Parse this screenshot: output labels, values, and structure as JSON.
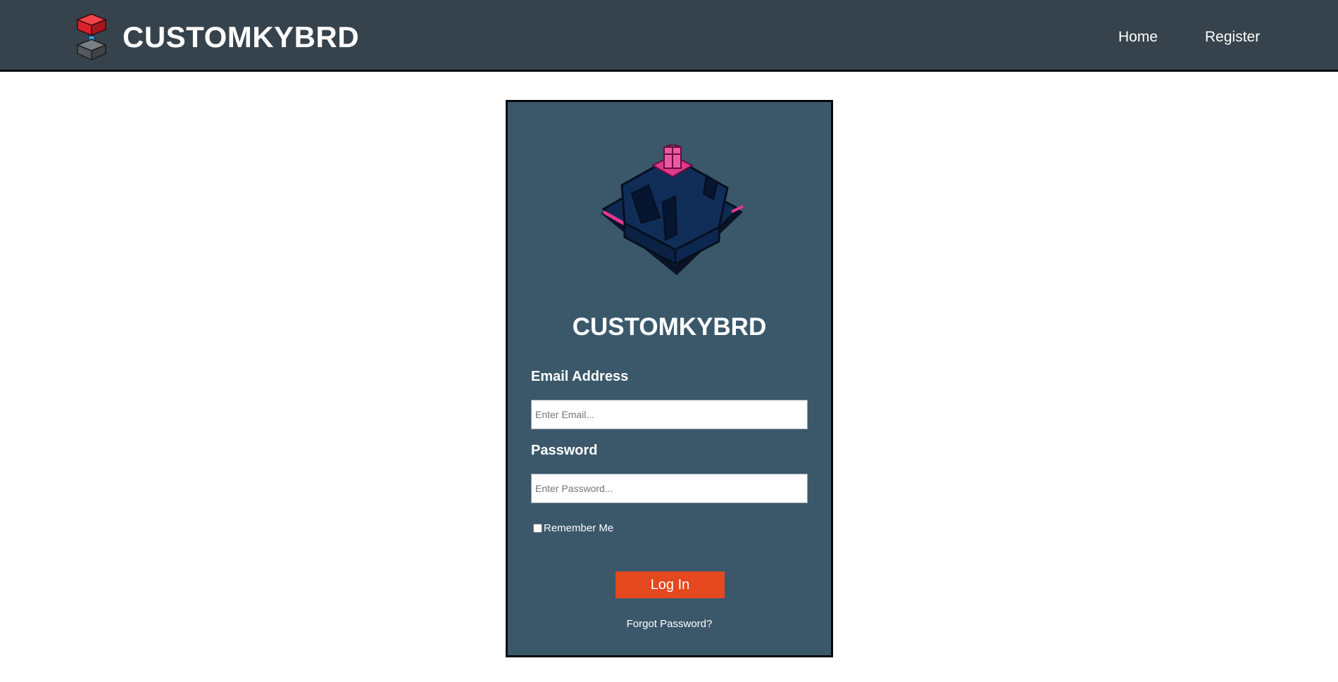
{
  "header": {
    "brand_name": "CUSTOMKYBRD",
    "logo_icon": "keyboard-switch-icon",
    "nav": {
      "home_label": "Home",
      "register_label": "Register"
    }
  },
  "login": {
    "illustration_icon": "mechanical-switch-icon",
    "title": "CUSTOMKYBRD",
    "email": {
      "label": "Email Address",
      "placeholder": "Enter Email...",
      "value": ""
    },
    "password": {
      "label": "Password",
      "placeholder": "Enter Password...",
      "value": ""
    },
    "remember_label": "Remember Me",
    "remember_checked": false,
    "submit_label": "Log In",
    "forgot_label": "Forgot Password?"
  },
  "colors": {
    "header_bg": "#37434c",
    "card_bg": "#3b586b",
    "button_bg": "#e5471e",
    "switch_stem": "#e0388f",
    "switch_housing": "#0f2a52"
  }
}
